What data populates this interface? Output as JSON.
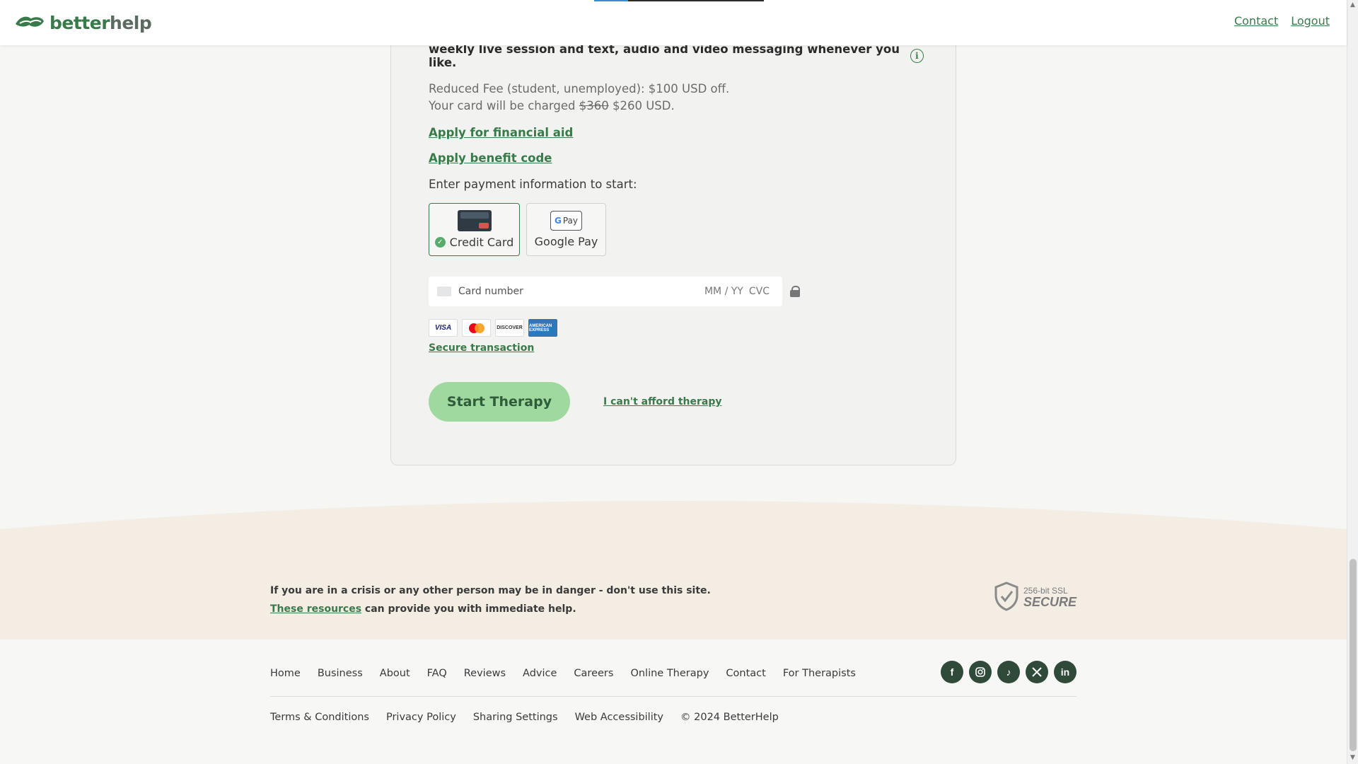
{
  "header": {
    "logo_part1": "better",
    "logo_part2": "help",
    "links": [
      "Contact",
      "Logout"
    ]
  },
  "plan": {
    "weekly_text": "weekly live session and text, audio and video messaging whenever you like.",
    "fee_line": "Reduced Fee (student, unemployed): $100 USD off.",
    "charge_prefix": "Your card will be charged",
    "charge_old": "$360",
    "charge_new": "$260 USD."
  },
  "links": {
    "financial_aid": "Apply for financial aid",
    "benefit_code": "Apply benefit code",
    "secure_transaction": "Secure transaction",
    "cant_afford": "I can't afford therapy"
  },
  "payment": {
    "prompt": "Enter payment information to start:",
    "methods": [
      {
        "label": "Credit Card",
        "selected": true
      },
      {
        "label": "Google Pay",
        "selected": false
      }
    ],
    "gpay_icon_text": "Pay",
    "card_placeholder": "Card number",
    "exp_placeholder": "MM / YY",
    "cvc_placeholder": "CVC",
    "brands": {
      "visa": "VISA",
      "discover": "DISCOVER",
      "amex": "AMERICAN EXPRESS"
    }
  },
  "cta": {
    "start_button": "Start Therapy"
  },
  "crisis": {
    "line1": "If you are in a crisis or any other person may be in danger - don't use this site.",
    "resources_link": "These resources",
    "line2_rest": " can provide you with immediate help."
  },
  "ssl": {
    "line1": "256-bit SSL",
    "line2": "SECURE"
  },
  "footer": {
    "nav": [
      "Home",
      "Business",
      "About",
      "FAQ",
      "Reviews",
      "Advice",
      "Careers",
      "Online Therapy",
      "Contact",
      "For Therapists"
    ],
    "legal": [
      "Terms & Conditions",
      "Privacy Policy",
      "Sharing Settings",
      "Web Accessibility",
      "© 2024 BetterHelp"
    ],
    "social": [
      "facebook-icon",
      "instagram-icon",
      "tiktok-icon",
      "x-icon",
      "linkedin-icon"
    ]
  },
  "colors": {
    "brand_green": "#397a4a",
    "cta_green": "#9fd99f",
    "band_beige": "#f4ede4"
  }
}
